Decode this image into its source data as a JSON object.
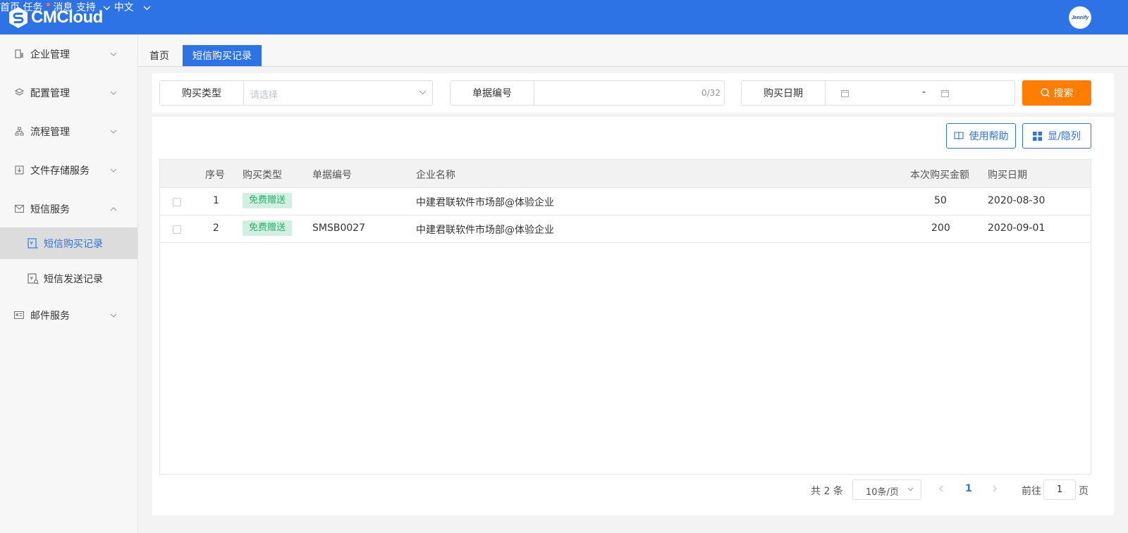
{
  "header": {
    "logo_text": "CMCloud",
    "nav": {
      "home": "首页",
      "tasks": "任务",
      "messages": "消息",
      "support": "支持",
      "language": "中文"
    },
    "avatar_text": "Jennify",
    "accent_color": "#2e73e5"
  },
  "sidebar": {
    "items": [
      {
        "label": "企业管理",
        "icon": "building-icon"
      },
      {
        "label": "配置管理",
        "icon": "layers-icon"
      },
      {
        "label": "流程管理",
        "icon": "flow-icon"
      },
      {
        "label": "文件存储服务",
        "icon": "download-box-icon"
      },
      {
        "label": "短信服务",
        "icon": "mail-icon"
      },
      {
        "label": "邮件服务",
        "icon": "id-card-icon"
      }
    ],
    "sms_sub": [
      {
        "label": "短信购买记录",
        "active": true
      },
      {
        "label": "短信发送记录",
        "active": false
      }
    ]
  },
  "tabs": {
    "home": "首页",
    "current": "短信购买记录"
  },
  "search": {
    "purchase_type_label": "购买类型",
    "purchase_type_placeholder": "请选择",
    "order_no_label": "单据编号",
    "order_no_count": "0/32",
    "date_label": "购买日期",
    "date_separator": "-",
    "search_button": "搜索",
    "search_button_color": "#ff7d00"
  },
  "toolbar": {
    "help_button": "使用帮助",
    "columns_button": "显/隐列"
  },
  "table": {
    "columns": [
      "序号",
      "购买类型",
      "单据编号",
      "企业名称",
      "本次购买金额",
      "购买日期"
    ],
    "rows": [
      {
        "index": "1",
        "type": "免费赠送",
        "order_no": "",
        "company": "中建君联软件市场部@体验企业",
        "amount": "50",
        "date": "2020-08-30"
      },
      {
        "index": "2",
        "type": "免费赠送",
        "order_no": "SMSB0027",
        "company": "中建君联软件市场部@体验企业",
        "amount": "200",
        "date": "2020-09-01"
      }
    ]
  },
  "pagination": {
    "total_prefix": "共",
    "total": "2",
    "total_suffix": "条",
    "page_size": "10条/页",
    "current_page": "1",
    "goto_label": "前往",
    "goto_value": "1",
    "goto_suffix": "页"
  }
}
